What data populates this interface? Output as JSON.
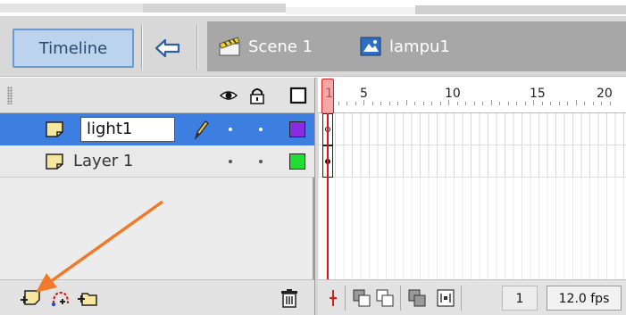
{
  "toolbar": {
    "timeline_label": "Timeline",
    "back_icon": "back-arrow-icon",
    "scene_label": "Scene 1",
    "symbol_label": "lampu1"
  },
  "layer_header": {
    "eye_icon": "eye-icon",
    "lock_icon": "lock-icon",
    "outline_icon": "outline-square-icon"
  },
  "layers": [
    {
      "name": "light1",
      "selected": true,
      "editing": true,
      "color": "#8a2be2"
    },
    {
      "name": "Layer 1",
      "selected": false,
      "editing": false,
      "color": "#22dd33"
    }
  ],
  "ruler": {
    "labels": [
      "1",
      "5",
      "10",
      "15",
      "20"
    ]
  },
  "frames_footer": {
    "current_frame": "1",
    "fps": "12.0 fps"
  },
  "colors": {
    "selected_row": "#3d7fe0",
    "playhead": "#e01414",
    "annotation_arrow": "#f07a2a"
  }
}
